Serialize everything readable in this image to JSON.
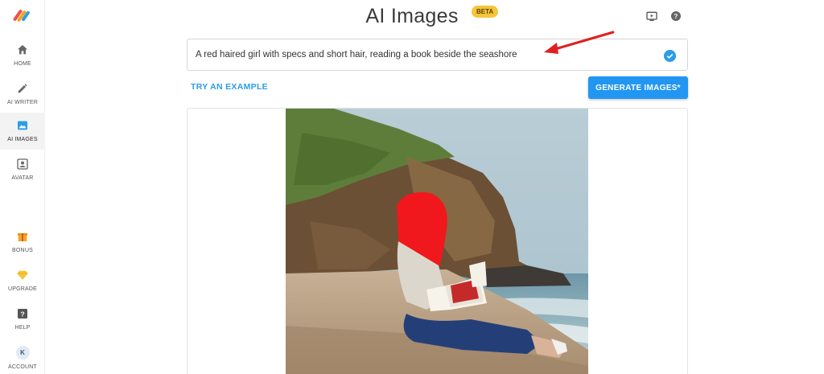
{
  "sidebar": {
    "items": [
      {
        "label": "HOME",
        "icon": "home-icon"
      },
      {
        "label": "AI WRITER",
        "icon": "pencil-icon"
      },
      {
        "label": "AI IMAGES",
        "icon": "image-icon",
        "active": true
      },
      {
        "label": "AVATAR",
        "icon": "avatar-icon"
      },
      {
        "label": "BONUS",
        "icon": "gift-icon"
      },
      {
        "label": "UPGRADE",
        "icon": "diamond-icon"
      },
      {
        "label": "HELP",
        "icon": "help-icon"
      },
      {
        "label": "ACCOUNT",
        "icon": "account-icon",
        "initial": "K"
      }
    ]
  },
  "header": {
    "title": "AI Images",
    "badge": "BETA"
  },
  "prompt": {
    "value": "A red haired girl with specs and short hair, reading a book beside the seashore"
  },
  "actions": {
    "try_example": "TRY AN EXAMPLE",
    "generate": "GENERATE IMAGES*"
  },
  "colors": {
    "accent": "#2196f3",
    "badge": "#f6c53a",
    "annotation_arrow": "#e02020"
  }
}
